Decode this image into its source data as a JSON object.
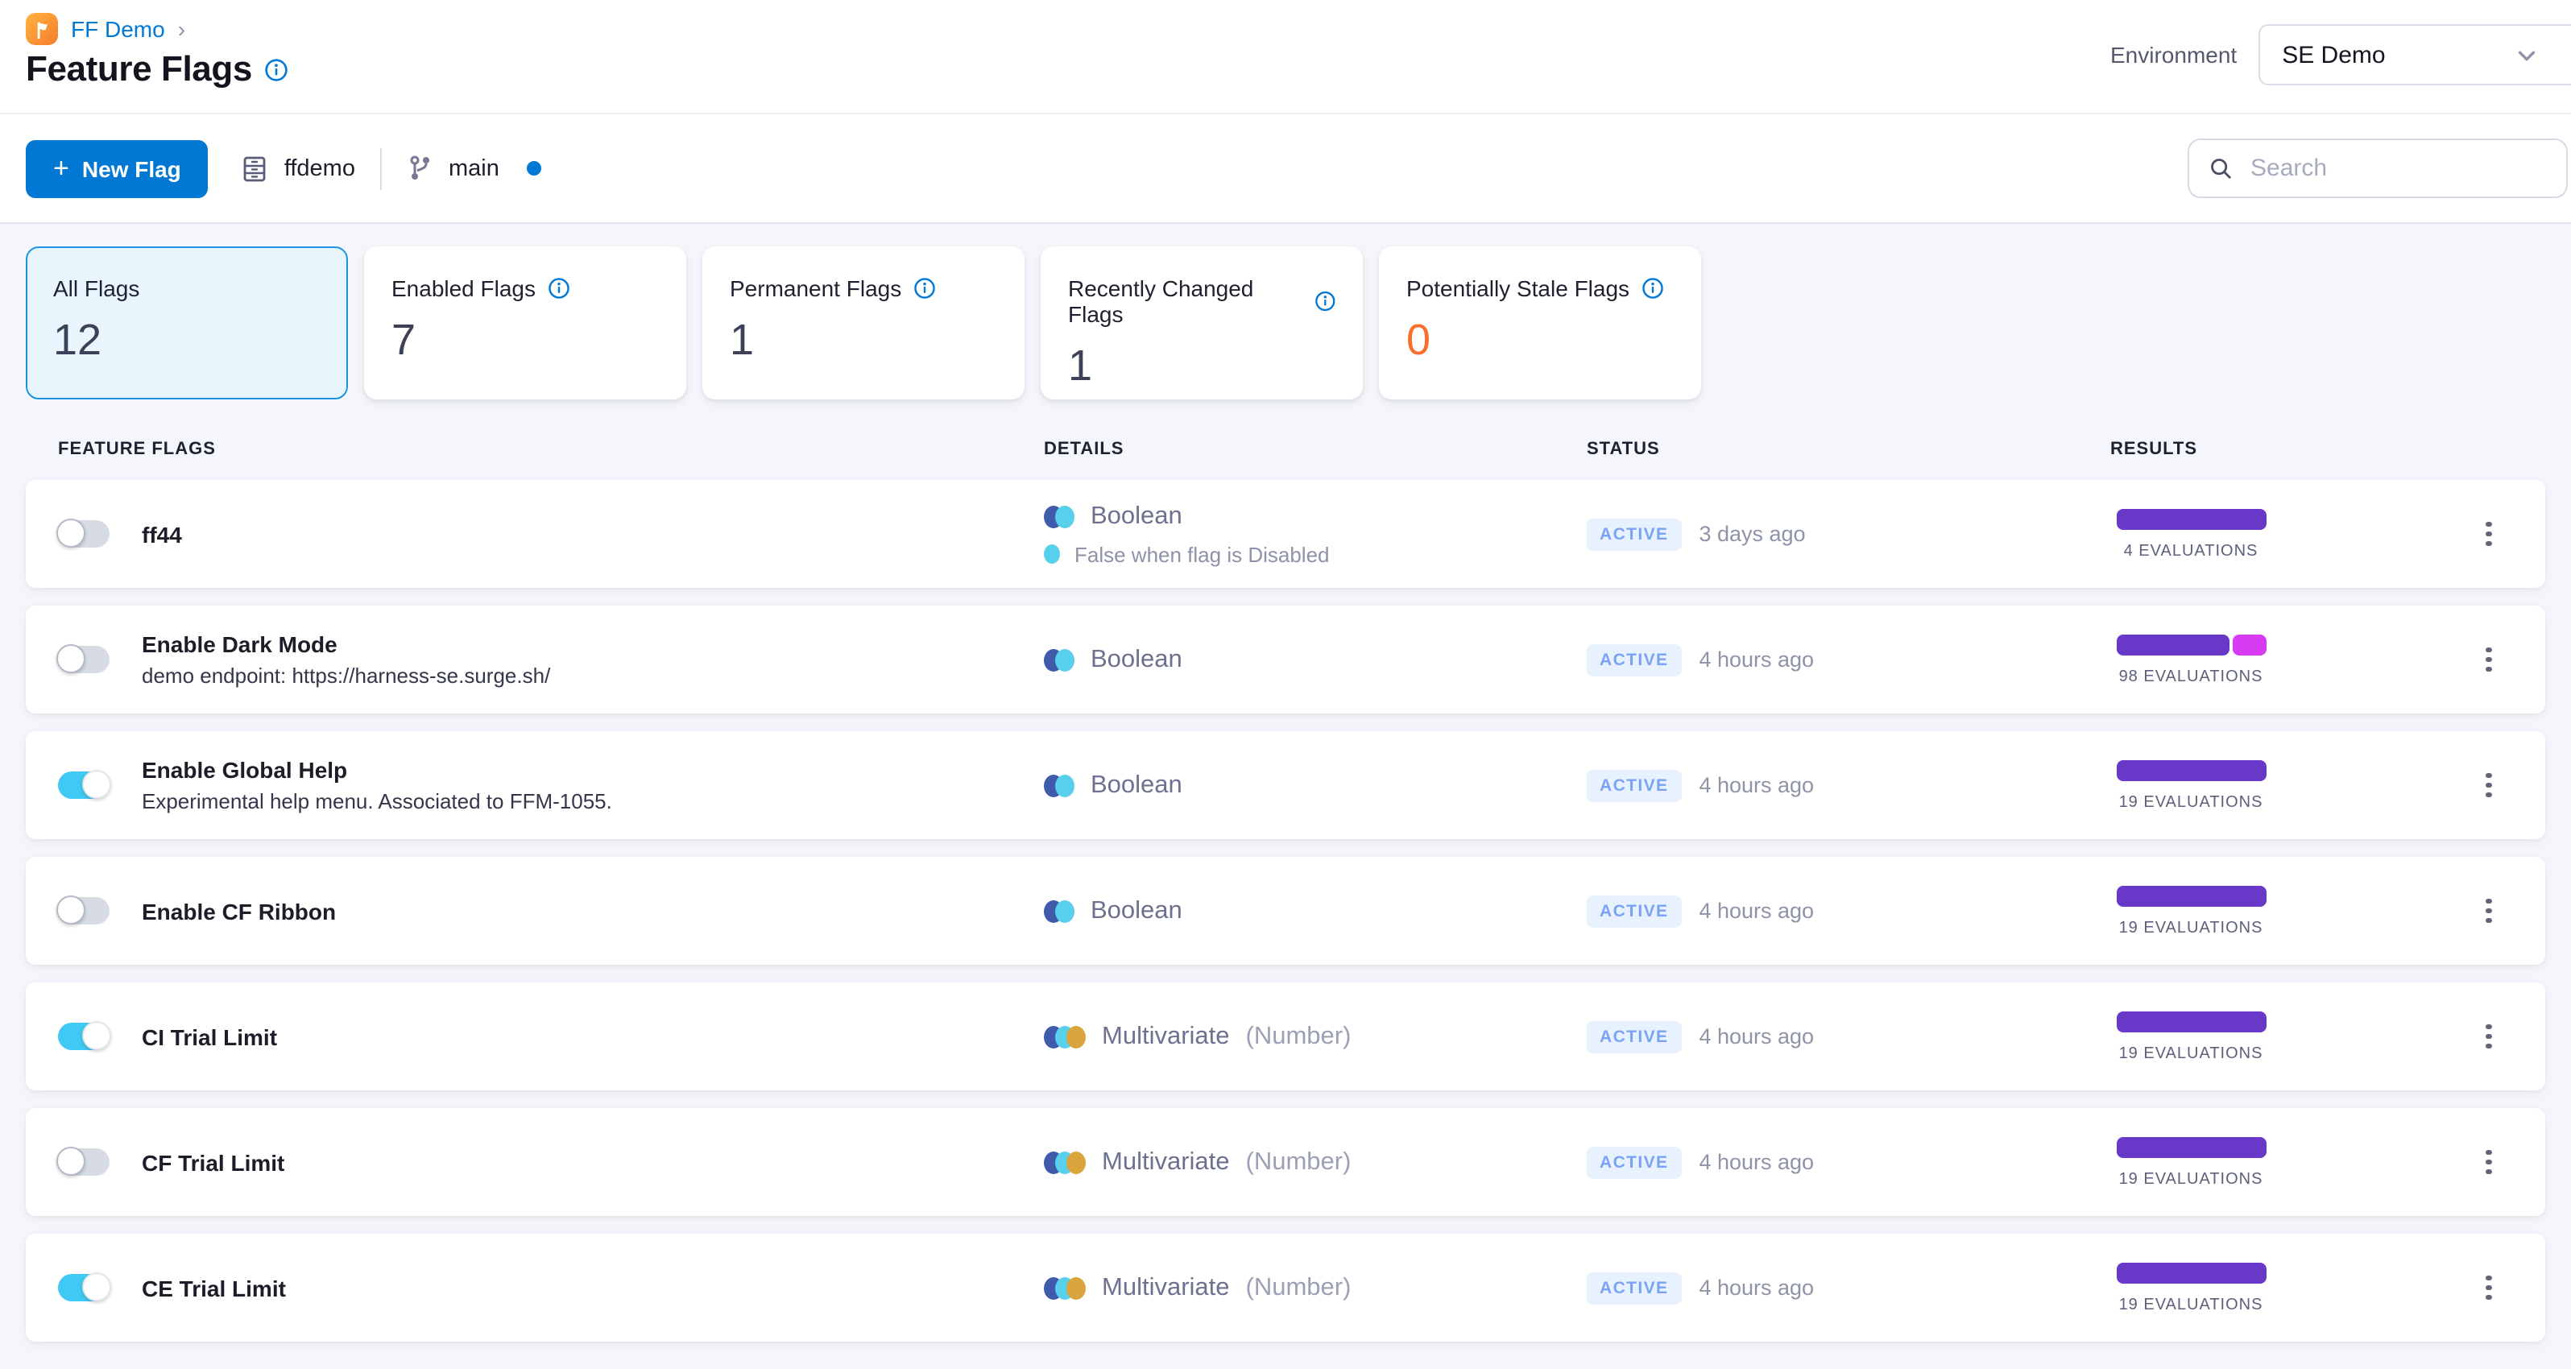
{
  "breadcrumb": {
    "project": "FF Demo",
    "chevron": "›"
  },
  "header": {
    "title": "Feature Flags",
    "environment_label": "Environment",
    "environment_value": "SE Demo"
  },
  "toolbar": {
    "plus_icon": "+",
    "new_flag_label": "New Flag",
    "repo_name": "ffdemo",
    "branch_name": "main",
    "search_placeholder": "Search"
  },
  "summary_cards": [
    {
      "label": "All Flags",
      "value": "12",
      "selected": true,
      "has_info": false,
      "value_color": "#3c4157"
    },
    {
      "label": "Enabled Flags",
      "value": "7",
      "selected": false,
      "has_info": true,
      "value_color": "#3c4157"
    },
    {
      "label": "Permanent Flags",
      "value": "1",
      "selected": false,
      "has_info": true,
      "value_color": "#3c4157"
    },
    {
      "label": "Recently Changed Flags",
      "value": "1",
      "selected": false,
      "has_info": true,
      "value_color": "#3c4157"
    },
    {
      "label": "Potentially Stale Flags",
      "value": "0",
      "selected": false,
      "has_info": true,
      "value_color": "#f96e2b"
    }
  ],
  "table": {
    "columns": [
      "FEATURE FLAGS",
      "DETAILS",
      "STATUS",
      "RESULTS"
    ],
    "rows": [
      {
        "name": "ff44",
        "description": "",
        "enabled": false,
        "kind": "boolean",
        "type_label": "Boolean",
        "type_note": "",
        "off_variation": "False when flag is Disabled",
        "status": "ACTIVE",
        "modified": "3 days ago",
        "evaluations_label": "4 EVALUATIONS",
        "bar_segments": [
          {
            "color": "#6838c9",
            "width": 93
          }
        ]
      },
      {
        "name": "Enable Dark Mode",
        "description": "demo endpoint: https://harness-se.surge.sh/",
        "enabled": false,
        "kind": "boolean",
        "type_label": "Boolean",
        "type_note": "",
        "off_variation": "",
        "status": "ACTIVE",
        "modified": "4 hours ago",
        "evaluations_label": "98 EVALUATIONS",
        "bar_segments": [
          {
            "color": "#6838c9",
            "width": 70
          },
          {
            "color": "#d63af2",
            "width": 21
          }
        ]
      },
      {
        "name": "Enable Global Help",
        "description": "Experimental help menu. Associated to FFM-1055.",
        "enabled": true,
        "kind": "boolean",
        "type_label": "Boolean",
        "type_note": "",
        "off_variation": "",
        "status": "ACTIVE",
        "modified": "4 hours ago",
        "evaluations_label": "19 EVALUATIONS",
        "bar_segments": [
          {
            "color": "#6838c9",
            "width": 93
          }
        ]
      },
      {
        "name": "Enable CF Ribbon",
        "description": "",
        "enabled": false,
        "kind": "boolean",
        "type_label": "Boolean",
        "type_note": "",
        "off_variation": "",
        "status": "ACTIVE",
        "modified": "4 hours ago",
        "evaluations_label": "19 EVALUATIONS",
        "bar_segments": [
          {
            "color": "#6838c9",
            "width": 93
          }
        ]
      },
      {
        "name": "CI Trial Limit",
        "description": "",
        "enabled": true,
        "kind": "multivariate",
        "type_label": "Multivariate",
        "type_note": "(Number)",
        "off_variation": "",
        "status": "ACTIVE",
        "modified": "4 hours ago",
        "evaluations_label": "19 EVALUATIONS",
        "bar_segments": [
          {
            "color": "#6838c9",
            "width": 93
          }
        ]
      },
      {
        "name": "CF Trial Limit",
        "description": "",
        "enabled": false,
        "kind": "multivariate",
        "type_label": "Multivariate",
        "type_note": "(Number)",
        "off_variation": "",
        "status": "ACTIVE",
        "modified": "4 hours ago",
        "evaluations_label": "19 EVALUATIONS",
        "bar_segments": [
          {
            "color": "#6838c9",
            "width": 93
          }
        ]
      },
      {
        "name": "CE Trial Limit",
        "description": "",
        "enabled": true,
        "kind": "multivariate",
        "type_label": "Multivariate",
        "type_note": "(Number)",
        "off_variation": "",
        "status": "ACTIVE",
        "modified": "4 hours ago",
        "evaluations_label": "19 EVALUATIONS",
        "bar_segments": [
          {
            "color": "#6838c9",
            "width": 93
          }
        ]
      }
    ]
  },
  "colors": {
    "primary": "#0278d5",
    "badge_bg": "#e8f1fe",
    "badge_text": "#7aa3f7",
    "toggle_on": "#41c9f5",
    "boolean_circles": [
      "#3f5ba9",
      "#58cfec"
    ],
    "multivariate_circles": [
      "#3f5ba9",
      "#58cfec",
      "#d9a53c"
    ],
    "off_variation_dot": "#58cfec"
  }
}
